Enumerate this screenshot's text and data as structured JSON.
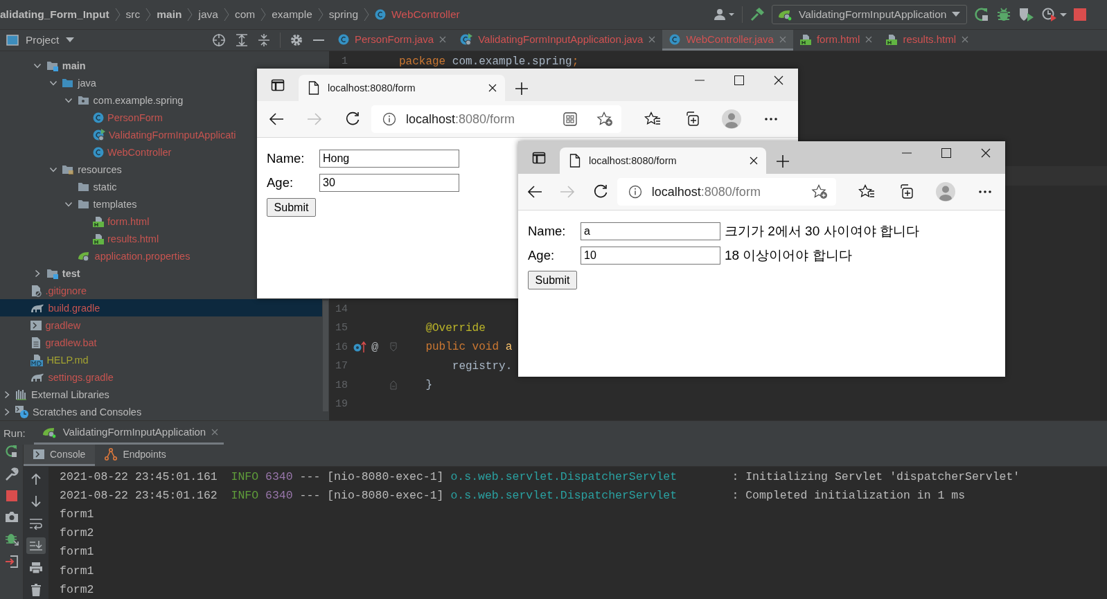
{
  "breadcrumb": [
    {
      "label": "alidating_Form_Input",
      "kind": "project"
    },
    {
      "label": "src",
      "kind": "folder"
    },
    {
      "label": "main",
      "kind": "module"
    },
    {
      "label": "java",
      "kind": "folder"
    },
    {
      "label": "com",
      "kind": "folder"
    },
    {
      "label": "example",
      "kind": "folder"
    },
    {
      "label": "spring",
      "kind": "folder"
    },
    {
      "label": "WebController",
      "kind": "class"
    }
  ],
  "toolbar": {
    "run_configuration": "ValidatingFormInputApplication"
  },
  "project_panel": {
    "title": "Project"
  },
  "tree": [
    {
      "children": [
        {
          "children": [
            {
              "label": "main",
              "kind": "module-folder",
              "bold": true,
              "expanded": true,
              "selected": false,
              "color": "#bbbbbb",
              "children": [
                {
                  "label": "java",
                  "kind": "source-folder",
                  "expanded": true,
                  "selected": false,
                  "color": "#bbbbbb",
                  "children": [
                    {
                      "label": "com.example.spring",
                      "kind": "package",
                      "expanded": true,
                      "selected": false,
                      "color": "#bbbbbb",
                      "children": [
                        {
                          "label": "PersonForm",
                          "kind": "class",
                          "selected": false,
                          "color": "#c75450"
                        },
                        {
                          "label": "ValidatingFormInputApplicati",
                          "kind": "spring-class",
                          "selected": false,
                          "color": "#c75450"
                        },
                        {
                          "label": "WebController",
                          "kind": "class",
                          "selected": false,
                          "color": "#c75450"
                        }
                      ]
                    }
                  ]
                },
                {
                  "label": "resources",
                  "kind": "resources-folder",
                  "expanded": true,
                  "selected": false,
                  "color": "#bbbbbb",
                  "children": [
                    {
                      "label": "static",
                      "kind": "folder",
                      "selected": false,
                      "color": "#bbbbbb"
                    },
                    {
                      "label": "templates",
                      "kind": "folder",
                      "expanded": true,
                      "selected": false,
                      "color": "#bbbbbb",
                      "children": [
                        {
                          "label": "form.html",
                          "kind": "html",
                          "selected": false,
                          "color": "#c75450"
                        },
                        {
                          "label": "results.html",
                          "kind": "html",
                          "selected": false,
                          "color": "#c75450"
                        }
                      ]
                    },
                    {
                      "label": "application.properties",
                      "kind": "properties",
                      "selected": false,
                      "color": "#c75450"
                    }
                  ]
                }
              ]
            },
            {
              "label": "test",
              "kind": "module-folder",
              "bold": true,
              "expanded": false,
              "selected": false,
              "color": "#bbbbbb"
            }
          ]
        },
        {
          "label": ".gitignore",
          "kind": "gitignore",
          "selected": false,
          "color": "#c75450"
        },
        {
          "label": "build.gradle",
          "kind": "gradle",
          "selected": true,
          "color": "#c75450"
        },
        {
          "label": "gradlew",
          "kind": "terminal",
          "selected": false,
          "color": "#c75450"
        },
        {
          "label": "gradlew.bat",
          "kind": "text-file",
          "selected": false,
          "color": "#c75450"
        },
        {
          "label": "HELP.md",
          "kind": "markdown",
          "selected": false,
          "color": "#a3a331"
        },
        {
          "label": "settings.gradle",
          "kind": "gradle",
          "selected": false,
          "color": "#c75450"
        }
      ]
    },
    {
      "label": "External Libraries",
      "kind": "libraries",
      "expanded": false,
      "selected": false,
      "color": "#bbbbbb"
    },
    {
      "label": "Scratches and Consoles",
      "kind": "scratches",
      "expanded": false,
      "selected": false,
      "color": "#bbbbbb"
    }
  ],
  "editor_tabs": [
    {
      "label": "PersonForm.java",
      "kind": "class",
      "selected": false
    },
    {
      "label": "ValidatingFormInputApplication.java",
      "kind": "spring-class",
      "selected": false
    },
    {
      "label": "WebController.java",
      "kind": "class",
      "selected": true
    },
    {
      "label": "form.html",
      "kind": "html",
      "selected": false
    },
    {
      "label": "results.html",
      "kind": "html",
      "selected": false
    }
  ],
  "editor": {
    "line_groups": [
      {
        "lines": [
          {
            "number": "1",
            "tokens": [
              {
                "text": "package",
                "kind": "keyword"
              },
              {
                "text": " com.example.spring",
                "kind": "plain"
              },
              {
                "text": ";",
                "kind": "keyword"
              }
            ]
          }
        ]
      },
      {
        "lines": [
          {
            "number": "14"
          },
          {
            "number": "15",
            "tokens": [
              {
                "text": "    @Override",
                "kind": "annotation"
              }
            ]
          },
          {
            "number": "16",
            "kind": "block_start",
            "overrides": true,
            "gutter_mark": "@",
            "tokens": [
              {
                "text": "    public void ",
                "kind": "keyword"
              },
              {
                "text": "a",
                "kind": "method"
              }
            ]
          },
          {
            "number": "17",
            "tokens": [
              {
                "text": "        registry.",
                "kind": "plain"
              }
            ]
          },
          {
            "number": "18",
            "kind": "block_end",
            "tokens": [
              {
                "text": "    }",
                "kind": "plain"
              }
            ]
          },
          {
            "number": "19"
          }
        ]
      }
    ]
  },
  "browsers": [
    {
      "focused": false,
      "tab_title": "localhost:8080/form",
      "host": "localhost",
      "path": ":8080/form",
      "can_go_forward": false,
      "fields": [
        {
          "label": "Name:",
          "value": "Hong"
        },
        {
          "label": "Age:",
          "value": "30"
        }
      ],
      "submit": "Submit"
    },
    {
      "focused": true,
      "tab_title": "localhost:8080/form",
      "host": "localhost",
      "path": ":8080/form",
      "can_go_forward": false,
      "fields": [
        {
          "label": "Name:",
          "value": "a",
          "error": "크기가 2에서 30 사이여야 합니다"
        },
        {
          "label": "Age:",
          "value": "10",
          "error": "18 이상이어야 합니다"
        }
      ],
      "submit": "Submit"
    }
  ],
  "run": {
    "label": "Run:",
    "tab": "ValidatingFormInputApplication",
    "scroll_to_end": true,
    "subtabs": [
      {
        "label": "Console",
        "kind": "console",
        "selected": true
      },
      {
        "label": "Endpoints",
        "kind": "endpoints",
        "selected": false
      }
    ],
    "console": [
      {
        "tokens": [
          {
            "text": "2021-08-22 23:45:01.161  ",
            "kind": "plain"
          },
          {
            "text": "INFO ",
            "kind": "level"
          },
          {
            "text": "6340",
            "kind": "pid"
          },
          {
            "text": " --- [nio-8080-exec-1] ",
            "kind": "plain"
          },
          {
            "text": "o.s.web.servlet.DispatcherServlet",
            "kind": "logger"
          },
          {
            "text": "        : Initializing Servlet 'dispatcherServlet'",
            "kind": "plain"
          }
        ]
      },
      {
        "tokens": [
          {
            "text": "2021-08-22 23:45:01.162  ",
            "kind": "plain"
          },
          {
            "text": "INFO ",
            "kind": "level"
          },
          {
            "text": "6340",
            "kind": "pid"
          },
          {
            "text": " --- [nio-8080-exec-1] ",
            "kind": "plain"
          },
          {
            "text": "o.s.web.servlet.DispatcherServlet",
            "kind": "logger"
          },
          {
            "text": "        : Completed initialization in 1 ms",
            "kind": "plain"
          }
        ]
      },
      {
        "tokens": [
          {
            "text": "form1",
            "kind": "plain"
          }
        ]
      },
      {
        "tokens": [
          {
            "text": "form2",
            "kind": "plain"
          }
        ]
      },
      {
        "tokens": [
          {
            "text": "form1",
            "kind": "plain"
          }
        ]
      },
      {
        "tokens": [
          {
            "text": "form1",
            "kind": "plain"
          }
        ]
      },
      {
        "tokens": [
          {
            "text": "form2",
            "kind": "plain"
          }
        ]
      }
    ]
  }
}
